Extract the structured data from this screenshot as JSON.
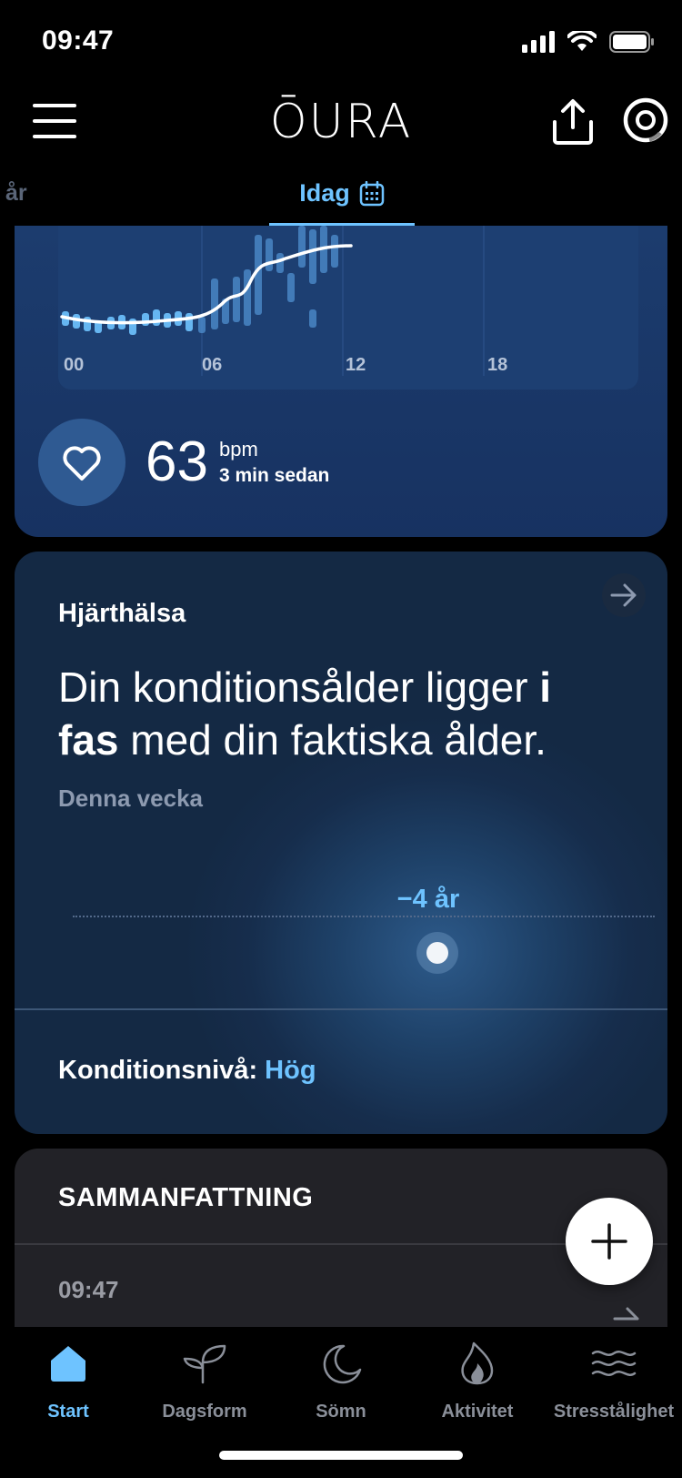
{
  "status_bar": {
    "time": "09:47"
  },
  "header": {
    "logo": "ŌURA"
  },
  "date_tabs": {
    "previous": "år",
    "current": "Idag"
  },
  "heart_rate": {
    "value": "63",
    "unit": "bpm",
    "updated": "3 min sedan",
    "x_ticks": [
      "00",
      "06",
      "12",
      "18"
    ]
  },
  "heart_health": {
    "title": "Hjärthälsa",
    "headline_pre": "Din konditionsålder ligger ",
    "headline_bold1": "i",
    "headline_bold2": "fas",
    "headline_post": " med din faktiska ålder.",
    "period": "Denna vecka",
    "delta": "−4 år",
    "fitness_label": "Konditionsnivå:",
    "fitness_value": "Hög"
  },
  "summary": {
    "title": "SAMMANFATTNING",
    "time": "09:47"
  },
  "bottom_nav": [
    {
      "label": "Start",
      "icon": "home-icon",
      "active": true
    },
    {
      "label": "Dagsform",
      "icon": "sprout-icon",
      "active": false
    },
    {
      "label": "Sömn",
      "icon": "moon-icon",
      "active": false
    },
    {
      "label": "Aktivitet",
      "icon": "flame-icon",
      "active": false
    },
    {
      "label": "Stresstålighet",
      "icon": "waves-icon",
      "active": false
    }
  ],
  "colors": {
    "accent": "#6ec3ff",
    "card_blue": "#1c3c6e",
    "summary_bg": "#222227"
  }
}
